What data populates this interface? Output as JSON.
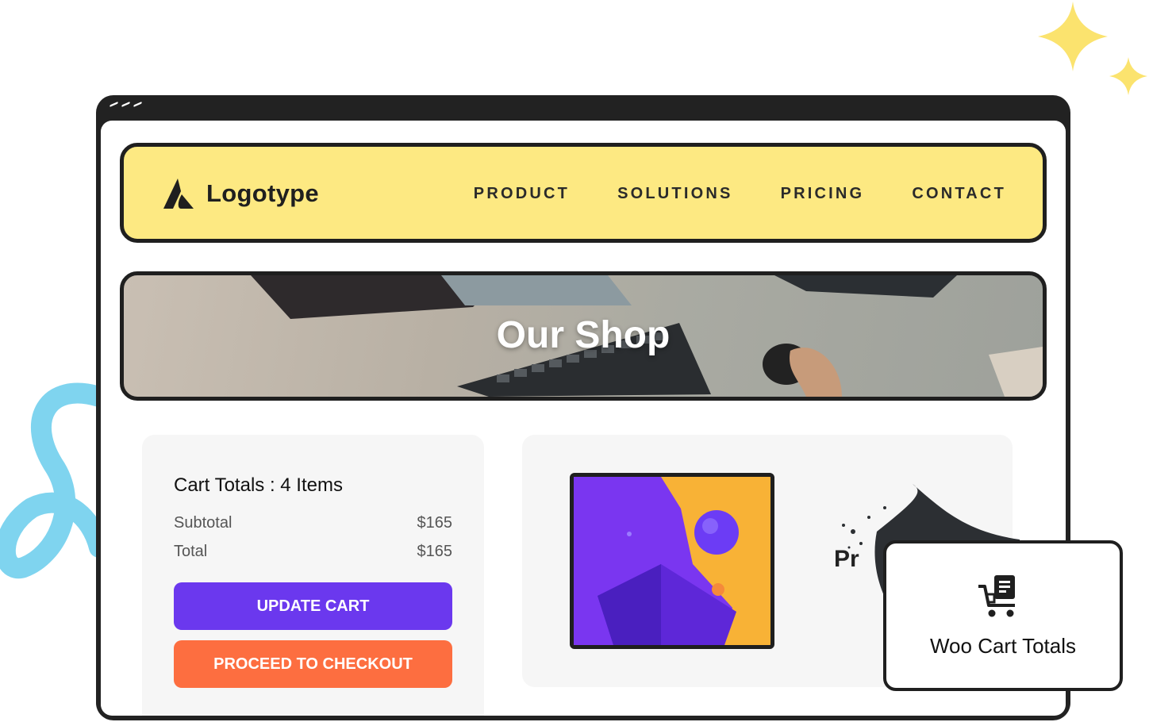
{
  "colors": {
    "nav_bg": "#fde982",
    "outline": "#1f1f1f",
    "update_button": "#6b38ee",
    "checkout_button": "#fd6e40",
    "card_bg": "#f6f6f6",
    "sparkle": "#fbe36e",
    "squiggle": "#7fd4ef"
  },
  "navbar": {
    "logo_icon": "logotype-mark-icon",
    "brand": "Logotype",
    "links": [
      "PRODUCT",
      "SOLUTIONS",
      "PRICING",
      "CONTACT"
    ]
  },
  "hero": {
    "title": "Our Shop"
  },
  "cart": {
    "title": "Cart Totals : 4 Items",
    "subtotal_label": "Subtotal",
    "subtotal_value": "$165",
    "total_label": "Total",
    "total_value": "$165",
    "update_button": "UPDATE CART",
    "checkout_button": "PROCEED TO CHECKOUT"
  },
  "product": {
    "label_partial": "Pr"
  },
  "widget": {
    "icon": "cart-receipt-icon",
    "label": "Woo Cart Totals"
  }
}
